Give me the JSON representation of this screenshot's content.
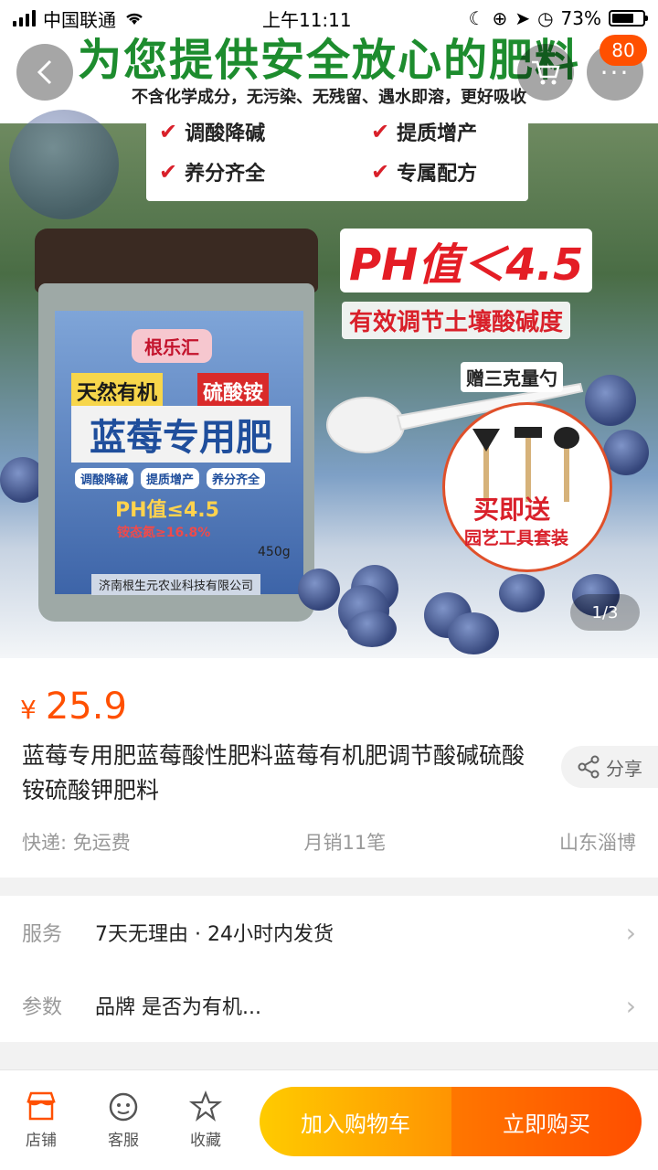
{
  "status_bar": {
    "carrier": "中国联通",
    "time": "上午11:11",
    "battery": "73%",
    "battery_level": 0.73
  },
  "hero": {
    "headline": "为您提供安全放心的肥料",
    "subline": "不含化学成分，无污染、无残留、遇水即溶，更好吸收",
    "benefits": [
      "调酸降碱",
      "提质增产",
      "养分齐全",
      "专属配方"
    ],
    "jar_label": {
      "brand": "根乐汇",
      "tag_a": "天然有机",
      "tag_b": "硫酸铵",
      "product": "蓝莓专用肥",
      "chips": [
        "调酸降碱",
        "提质增产",
        "养分齐全"
      ],
      "ph": "PH值≤4.5",
      "nitrogen": "铵态氮≥16.8%",
      "weight": "450g",
      "company": "济南根生元农业科技有限公司"
    },
    "ph_claim": "PH值＜4.5",
    "ph_note": "有效调节土壤酸碱度",
    "spoon_note": "赠三克量勺",
    "gift_title": "买即送",
    "gift_sub": "园艺工具套装",
    "counter": "1/3"
  },
  "cart_badge": "80",
  "product": {
    "currency": "¥",
    "price": "25.9",
    "title": "蓝莓专用肥蓝莓酸性肥料蓝莓有机肥调节酸碱硫酸铵硫酸钾肥料",
    "share": "分享",
    "shipping": "快递: 免运费",
    "monthly_sales": "月销11笔",
    "location": "山东淄博"
  },
  "service": {
    "rows": [
      {
        "key": "服务",
        "value": "7天无理由 · 24小时内发货"
      },
      {
        "key": "参数",
        "value": "品牌 是否为有机..."
      }
    ]
  },
  "bottom_bar": {
    "shop": "店铺",
    "service": "客服",
    "favorite": "收藏",
    "add_to_cart": "加入购物车",
    "buy_now": "立即购买"
  },
  "colors": {
    "accent": "#ff5000",
    "cart_button": "#ff9402",
    "buy_button": "#ff4e00"
  }
}
